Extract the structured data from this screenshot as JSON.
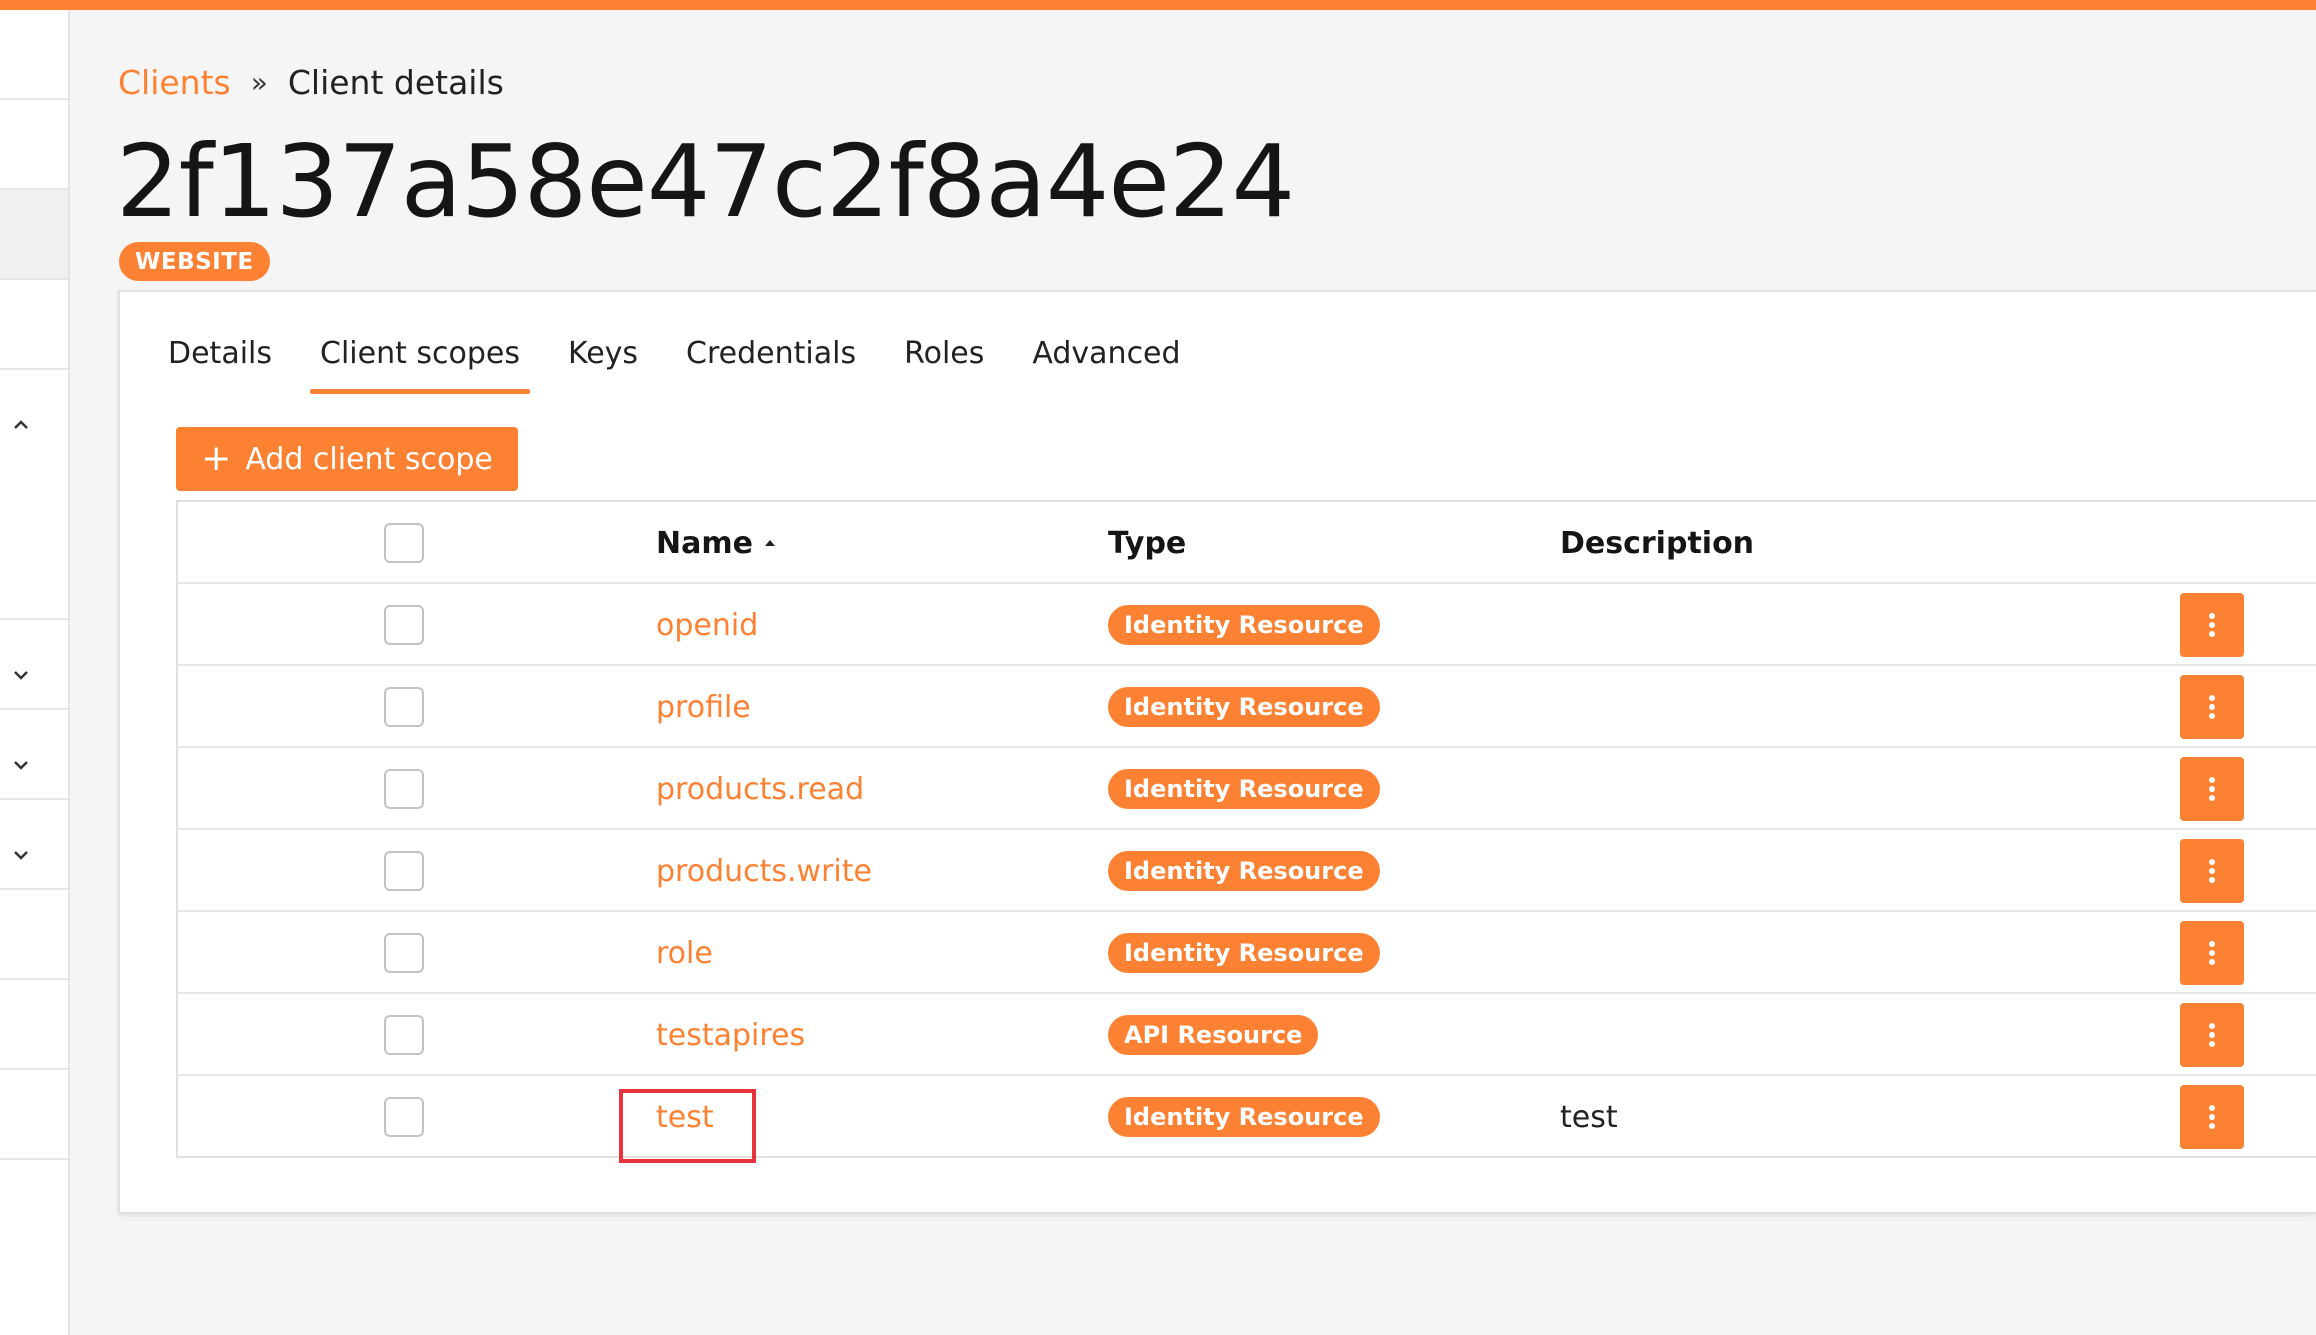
{
  "breadcrumb": {
    "parent": "Clients",
    "separator": "»",
    "current": "Client details"
  },
  "client": {
    "id": "2f137a58e47c2f8a4e24",
    "badge": "WEBSITE"
  },
  "tabs": [
    "Details",
    "Client scopes",
    "Keys",
    "Credentials",
    "Roles",
    "Advanced"
  ],
  "active_tab": "Client scopes",
  "toolbar": {
    "add_label": "Add client scope"
  },
  "table": {
    "headers": {
      "name": "Name",
      "type": "Type",
      "description": "Description"
    },
    "rows": [
      {
        "name": "openid",
        "type": "Identity Resource",
        "description": ""
      },
      {
        "name": "profile",
        "type": "Identity Resource",
        "description": ""
      },
      {
        "name": "products.read",
        "type": "Identity Resource",
        "description": ""
      },
      {
        "name": "products.write",
        "type": "Identity Resource",
        "description": ""
      },
      {
        "name": "role",
        "type": "Identity Resource",
        "description": ""
      },
      {
        "name": "testapires",
        "type": "API Resource",
        "description": ""
      },
      {
        "name": "test",
        "type": "Identity Resource",
        "description": "test"
      }
    ]
  },
  "colors": {
    "accent": "#fd8133",
    "highlight": "#e8323c"
  },
  "icons": {
    "sort": "caret-up-icon",
    "row_action": "kebab-icon",
    "add": "plus-icon"
  }
}
